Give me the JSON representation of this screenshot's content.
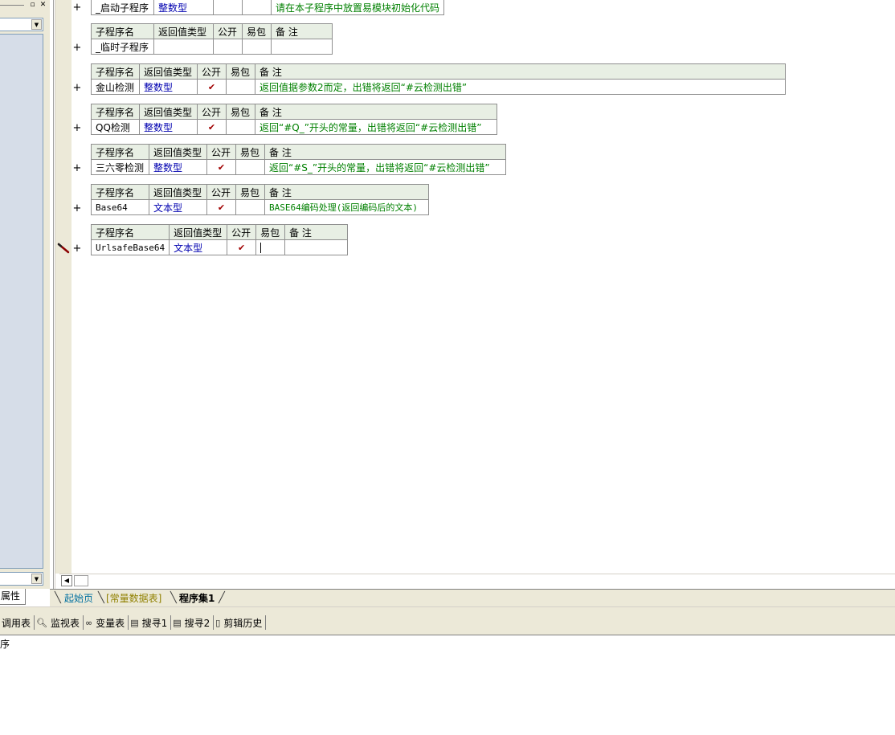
{
  "left_panel": {
    "restore_glyph": "▫",
    "close_glyph": "✕",
    "dropdown_glyph": "▼",
    "property_tab": "属性"
  },
  "headers": {
    "name": "子程序名",
    "return_type": "返回值类型",
    "public": "公开",
    "easy_pack": "易包",
    "note": "备 注"
  },
  "subroutines": [
    {
      "name": "_启动子程序",
      "type": "整数型",
      "public": "",
      "easy_pack": "",
      "note": "请在本子程序中放置易模块初始化代码"
    },
    {
      "name": "_临时子程序",
      "type": "",
      "public": "",
      "easy_pack": "",
      "note": ""
    },
    {
      "name": "金山检测",
      "type": "整数型",
      "public": "✔",
      "easy_pack": "",
      "note": "返回值据参数2而定，出错将返回“#云检测出错”"
    },
    {
      "name": "QQ检测",
      "type": "整数型",
      "public": "✔",
      "easy_pack": "",
      "note": "返回“#Q_”开头的常量，出错将返回“#云检测出错”"
    },
    {
      "name": "三六零检测",
      "type": "整数型",
      "public": "✔",
      "easy_pack": "",
      "note": "返回“#S_”开头的常量，出错将返回“#云检测出错”"
    },
    {
      "name": "Base64",
      "type": "文本型",
      "public": "✔",
      "easy_pack": "",
      "note": "BASE64编码处理(返回编码后的文本)"
    },
    {
      "name": "UrlsafeBase64",
      "type": "文本型",
      "public": "✔",
      "easy_pack": "",
      "note": ""
    }
  ],
  "expand_glyph": "+",
  "tabs": {
    "start_page": "起始页",
    "const_table": "[常量数据表]",
    "program_set": "程序集1"
  },
  "toolbar": {
    "call_table": "调用表",
    "watch_table": "监视表",
    "var_table": "变量表",
    "search1": "搜寻1",
    "search2": "搜寻2",
    "clip_history": "剪辑历史"
  },
  "output": {
    "text": "序"
  }
}
